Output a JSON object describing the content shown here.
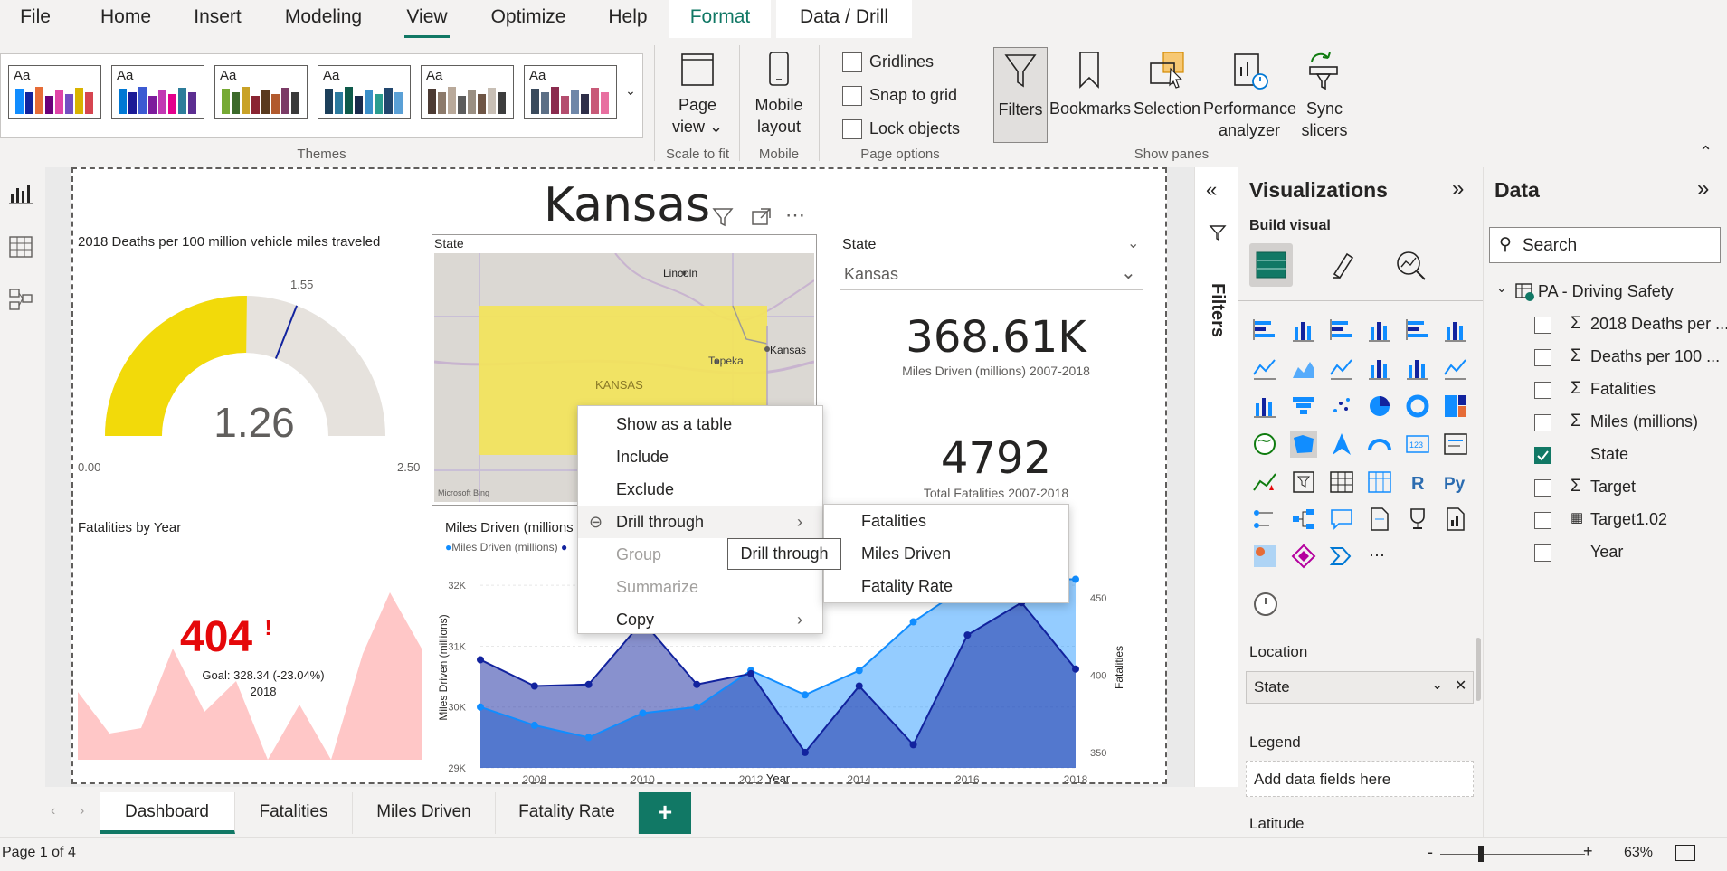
{
  "menu": {
    "file": "File",
    "home": "Home",
    "insert": "Insert",
    "modeling": "Modeling",
    "view": "View",
    "optimize": "Optimize",
    "help": "Help",
    "format": "Format",
    "data_drill": "Data / Drill"
  },
  "ribbon": {
    "themes_label": "Themes",
    "theme_text": "Aa",
    "page_view": [
      "Page",
      "view"
    ],
    "scale_to_fit": "Scale to fit",
    "mobile_layout": [
      "Mobile",
      "layout"
    ],
    "mobile": "Mobile",
    "gridlines": "Gridlines",
    "snap_to_grid": "Snap to grid",
    "lock_objects": "Lock objects",
    "page_options": "Page options",
    "filters": "Filters",
    "bookmarks": "Bookmarks",
    "selection": "Selection",
    "performance_analyzer": [
      "Performance",
      "analyzer"
    ],
    "sync_slicers": [
      "Sync",
      "slicers"
    ],
    "show_panes": "Show panes"
  },
  "report": {
    "title": "Kansas",
    "gauge": {
      "title": "2018 Deaths per 100 million vehicle miles traveled",
      "value": "1.26",
      "target": "1.55",
      "min": "0.00",
      "max": "2.50",
      "value_num": 1.26,
      "target_num": 1.55,
      "max_num": 2.5
    },
    "map": {
      "title": "State",
      "labels": [
        "Lincoln",
        "Topeka",
        "Kansas",
        "KANSAS"
      ],
      "attribution": "Microsoft Bing"
    },
    "slicer": {
      "title": "State",
      "value": "Kansas"
    },
    "card1": {
      "value": "368.61K",
      "label": "Miles Driven (millions) 2007-2018"
    },
    "card2": {
      "value": "4792",
      "label": "Total Fatalities 2007-2018"
    },
    "kpi": {
      "title": "Fatalities by Year",
      "value": "404",
      "indicator": "!",
      "goal": "Goal: 328.34 (-23.04%)",
      "year": "2018"
    },
    "combo": {
      "title": "Miles Driven (millions",
      "legend1": "Miles Driven (millions)",
      "xlabel": "Year",
      "ylabel": "Miles Driven (millions)",
      "y2label": "Fatalities"
    }
  },
  "context_menu": {
    "items": [
      "Show as a table",
      "Include",
      "Exclude",
      "Drill through",
      "Group",
      "Summarize",
      "Copy"
    ],
    "submenu": [
      "Fatalities",
      "Miles Driven",
      "Fatality Rate"
    ],
    "tooltip": "Drill through"
  },
  "filters_pane": {
    "label": "Filters"
  },
  "visualizations": {
    "title": "Visualizations",
    "build_visual": "Build visual",
    "location_label": "Location",
    "location_field": "State",
    "legend_label": "Legend",
    "legend_placeholder": "Add data fields here",
    "latitude_label": "Latitude"
  },
  "data_pane": {
    "title": "Data",
    "search_placeholder": "Search",
    "table": "PA - Driving Safety",
    "fields": [
      {
        "name": "2018 Deaths per ...",
        "sigma": true,
        "checked": false
      },
      {
        "name": "Deaths per 100 ...",
        "sigma": true,
        "checked": false
      },
      {
        "name": "Fatalities",
        "sigma": true,
        "checked": false
      },
      {
        "name": "Miles (millions)",
        "sigma": true,
        "checked": false
      },
      {
        "name": "State",
        "sigma": false,
        "checked": true
      },
      {
        "name": "Target",
        "sigma": true,
        "checked": false
      },
      {
        "name": "Target1.02",
        "sigma": false,
        "checked": false
      },
      {
        "name": "Year",
        "sigma": false,
        "checked": false
      }
    ]
  },
  "tabs": [
    "Dashboard",
    "Fatalities",
    "Miles Driven",
    "Fatality Rate"
  ],
  "status": {
    "page": "Page 1 of 4",
    "zoom": "63%"
  },
  "chart_data": {
    "type": "line",
    "x": [
      2007,
      2008,
      2009,
      2010,
      2011,
      2012,
      2013,
      2014,
      2015,
      2016,
      2017,
      2018
    ],
    "series": [
      {
        "name": "Miles Driven (millions)",
        "axis": "left",
        "values": [
          30000,
          29700,
          29500,
          29900,
          30000,
          30600,
          30200,
          30600,
          31400,
          32000,
          32100,
          32100
        ]
      },
      {
        "axis": "right",
        "values": [
          410,
          393,
          394,
          435,
          394,
          401,
          350,
          393,
          355,
          426,
          447,
          404
        ]
      }
    ],
    "xticks": [
      "2008",
      "2010",
      "2012",
      "2014",
      "2016",
      "2018"
    ],
    "yticks": [
      "29K",
      "30K",
      "31K",
      "32K"
    ],
    "y2ticks": [
      "350",
      "400",
      "450"
    ],
    "ylim": [
      29000,
      32300
    ],
    "y2lim": [
      340,
      470
    ],
    "colors": [
      "#118dff",
      "#12239e"
    ]
  },
  "colors": {
    "accent": "#117865",
    "gauge_fill": "#f2da0a",
    "kpi_red": "#e5080a",
    "kpi_area": "#ffc7c7",
    "map_state": "#f3e45a"
  }
}
